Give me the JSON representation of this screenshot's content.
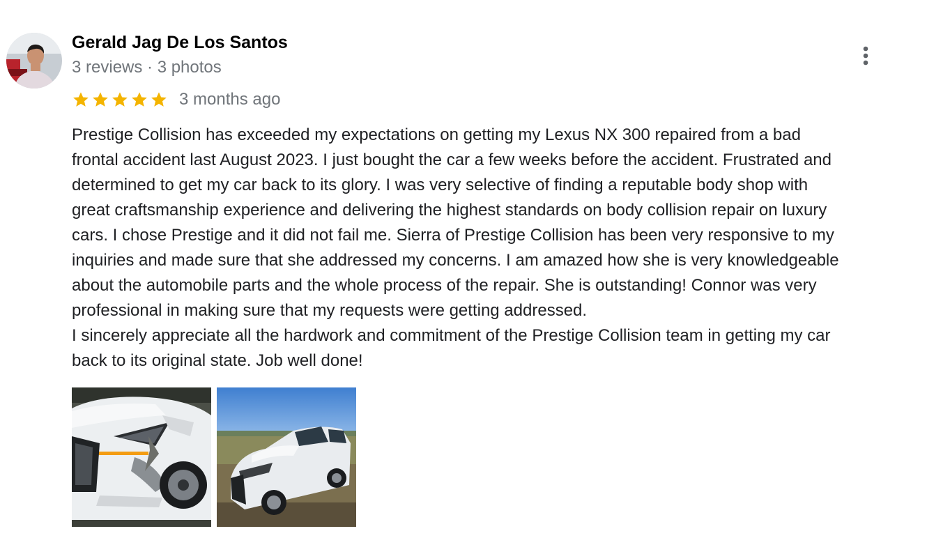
{
  "review": {
    "author_name": "Gerald Jag De Los Santos",
    "author_meta": "3 reviews · 3 photos",
    "rating": 5,
    "rating_max": 5,
    "date": "3 months ago",
    "text_lines": [
      "Prestige Collision has exceeded my expectations on getting my Lexus NX 300 repaired from a bad",
      "frontal accident last August 2023. I just bought the car a few weeks before the accident. Frustrated and",
      "determined to get my car back to its glory. I was very selective of finding a reputable body shop with",
      "great craftsmanship experience and delivering the highest standards on body collision repair on luxury",
      "cars. I chose Prestige and it did not fail me. Sierra of Prestige Collision has been very responsive to my",
      "inquiries and made sure that she addressed my concerns. I am amazed how she is very knowledgeable",
      "about the automobile parts and the whole process of the repair. She is outstanding! Connor was very",
      "professional in making sure that my requests were getting addressed.",
      "I sincerely appreciate all the hardwork and commitment of the Prestige Collision team in getting my car",
      "back to its original state.  Job well done!"
    ],
    "photos": [
      {
        "icon": "damaged-car-photo"
      },
      {
        "icon": "repaired-car-photo"
      }
    ]
  },
  "icons": {
    "more": "more-vert-icon",
    "star": "star-icon",
    "avatar": "avatar"
  },
  "colors": {
    "star": "#f4b400",
    "text": "#202124",
    "muted": "#70757a",
    "name": "#000000",
    "kebab": "#5f6368"
  }
}
